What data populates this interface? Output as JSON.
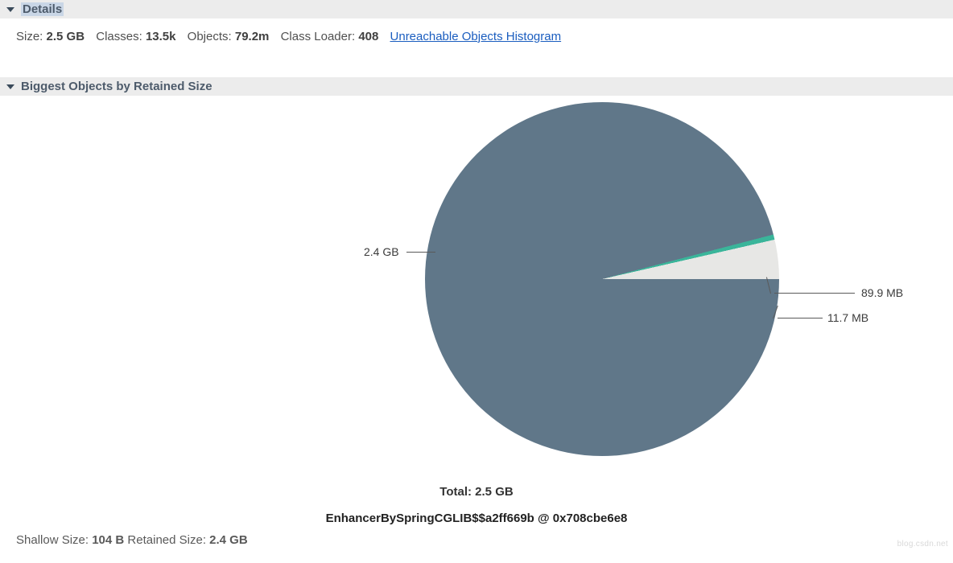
{
  "sections": {
    "details": {
      "title": "Details",
      "fields": {
        "size_label": "Size:",
        "size_value": "2.5 GB",
        "classes_label": "Classes:",
        "classes_value": "13.5k",
        "objects_label": "Objects:",
        "objects_value": "79.2m",
        "classloader_label": "Class Loader:",
        "classloader_value": "408",
        "link_text": "Unreachable Objects Histogram"
      }
    },
    "biggest": {
      "title": "Biggest Objects by Retained Size",
      "total_label": "Total: 2.5 GB",
      "object_name": "EnhancerBySpringCGLIB$$a2ff669b @ 0x708cbe6e8"
    }
  },
  "footer": {
    "shallow_label": "Shallow Size:",
    "shallow_value": "104 B",
    "retained_label": "Retained Size:",
    "retained_value": "2.4 GB"
  },
  "chart_data": {
    "type": "pie",
    "title": "Biggest Objects by Retained Size",
    "total": "2.5 GB",
    "slices": [
      {
        "label": "2.4 GB",
        "bytes": 2576980378,
        "color": "#607789"
      },
      {
        "label": "11.7 MB",
        "bytes": 12268339,
        "color": "#3ab59a"
      },
      {
        "label": "89.9 MB",
        "bytes": 94266982,
        "color": "#e7e7e5"
      }
    ],
    "slice_labels": {
      "big": "2.4 GB",
      "small": "11.7 MB",
      "rest": "89.9 MB"
    }
  },
  "watermark": "blog.csdn.net"
}
